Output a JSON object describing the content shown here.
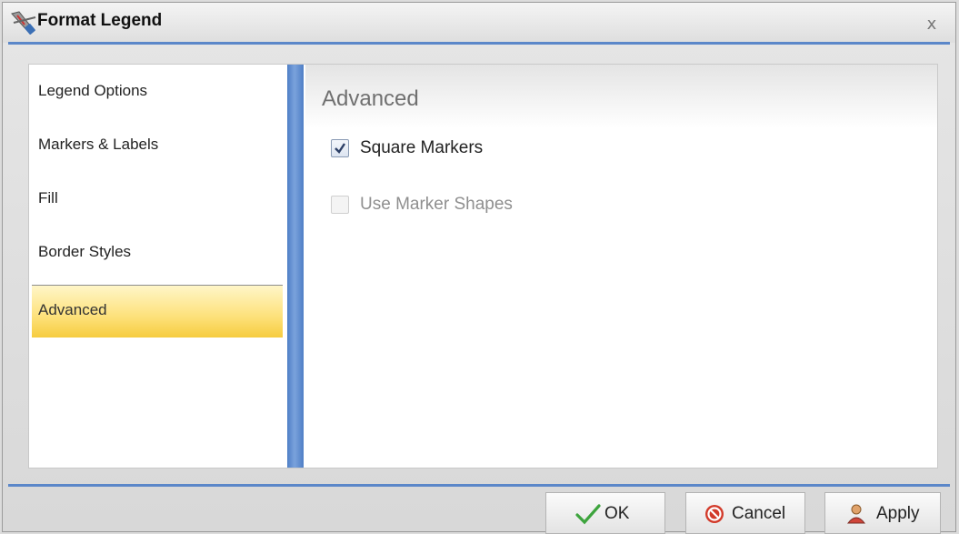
{
  "window": {
    "title": "Format Legend",
    "close_glyph": "x"
  },
  "nav": {
    "items": [
      {
        "label": "Legend Options",
        "selected": false
      },
      {
        "label": "Markers & Labels",
        "selected": false
      },
      {
        "label": "Fill",
        "selected": false
      },
      {
        "label": "Border Styles",
        "selected": false
      },
      {
        "label": "Advanced",
        "selected": true
      }
    ]
  },
  "panel": {
    "title": "Advanced",
    "options": [
      {
        "label": "Square Markers",
        "checked": true,
        "enabled": true
      },
      {
        "label": "Use Marker Shapes",
        "checked": false,
        "enabled": false
      }
    ]
  },
  "buttons": {
    "ok": {
      "label": "OK",
      "icon": "checkmark-icon"
    },
    "cancel": {
      "label": "Cancel",
      "icon": "no-entry-icon"
    },
    "apply": {
      "label": "Apply",
      "icon": "user-icon"
    }
  },
  "colors": {
    "accent": "#5b87c9",
    "selected_item": "#fde17a",
    "ok_check": "#3da43d",
    "cancel_red": "#d23a2a"
  }
}
